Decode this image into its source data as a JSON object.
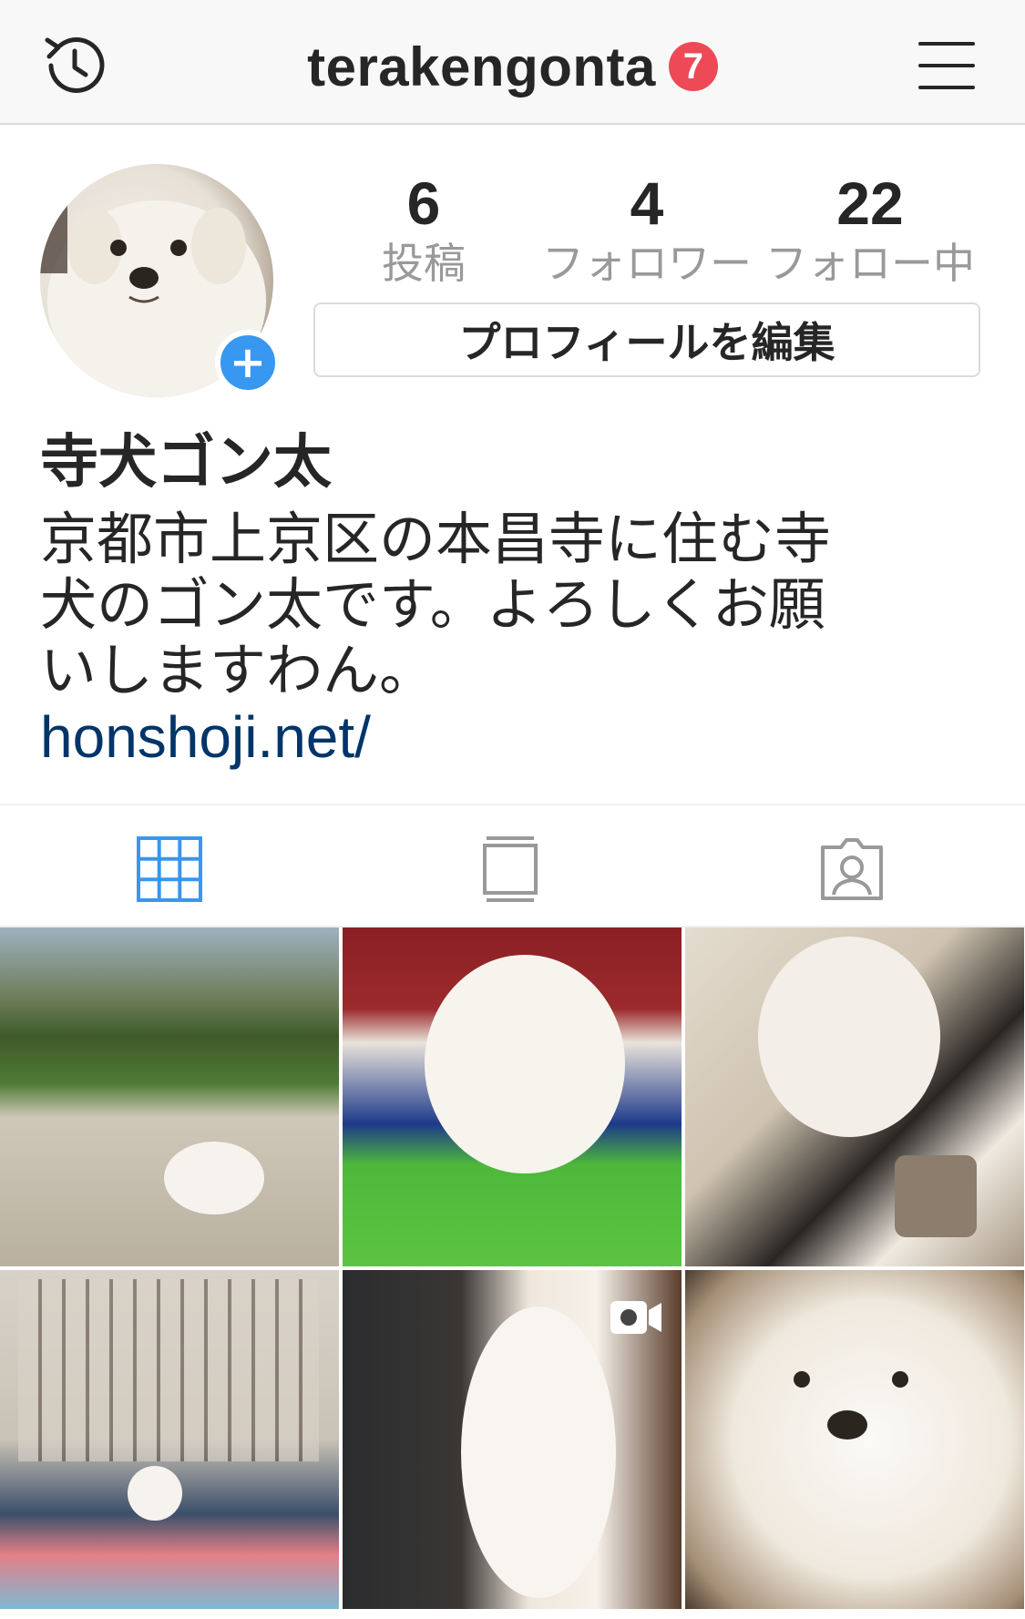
{
  "header": {
    "title": "terakengonta",
    "badge_count": "7",
    "history_icon": "history-clock-icon",
    "menu_icon": "hamburger-menu-icon",
    "badge_color": "#ed4956"
  },
  "profile": {
    "add_story_symbol": "+",
    "stats": {
      "posts": {
        "value": "6",
        "label": "投稿"
      },
      "followers": {
        "value": "4",
        "label": "フォロワー"
      },
      "following": {
        "value": "22",
        "label": "フォロー中"
      }
    },
    "edit_button_label": "プロフィールを編集",
    "display_name": "寺犬ゴン太",
    "bio_lines": [
      "京都市上京区の本昌寺に住む寺",
      "犬のゴン太です。よろしくお願",
      "いしますわん。"
    ],
    "link": "honshoji.net/",
    "link_color": "#003569",
    "accent_color": "#3897f0"
  },
  "tabs": {
    "items": [
      {
        "icon": "grid-icon",
        "active": true
      },
      {
        "icon": "feed-icon",
        "active": false
      },
      {
        "icon": "tagged-icon",
        "active": false
      }
    ]
  },
  "grid": {
    "photos": [
      {
        "subject": "dog-on-temple-path"
      },
      {
        "subject": "dog-on-striped-towel"
      },
      {
        "subject": "dog-with-tea-cup"
      },
      {
        "subject": "yoga-class-with-dog"
      },
      {
        "subject": "dog-standing-video",
        "icon": "video-icon"
      },
      {
        "subject": "dog-closeup"
      }
    ]
  }
}
